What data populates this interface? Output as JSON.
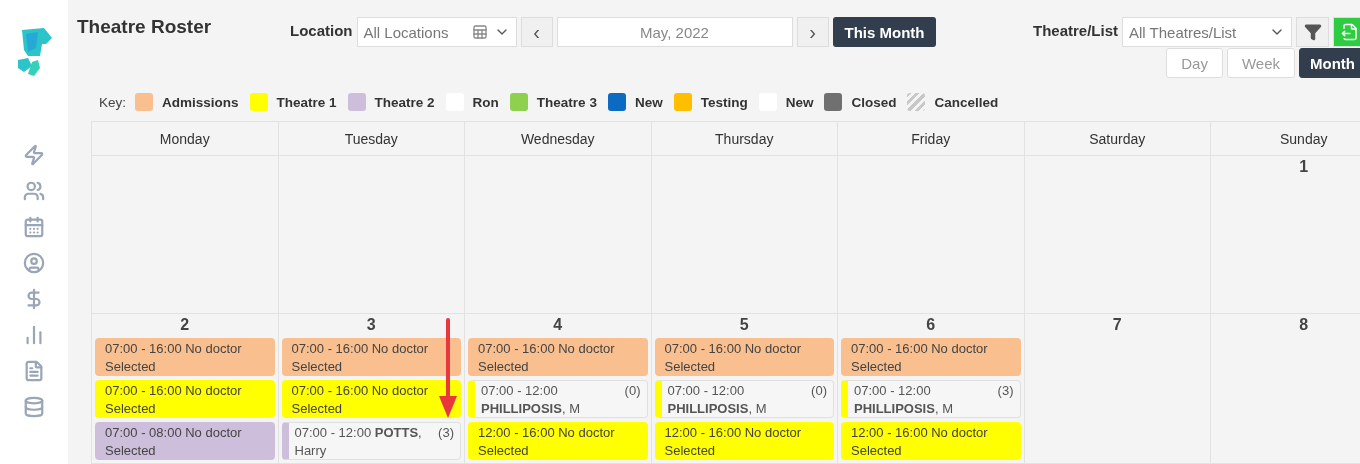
{
  "title": "Theatre Roster",
  "location": {
    "label": "Location",
    "value": "All Locations"
  },
  "date_nav": {
    "prev": "‹",
    "value": "May, 2022",
    "next": "›",
    "today": "This Month"
  },
  "theatre_filter": {
    "label": "Theatre/List",
    "value": "All Theatres/List"
  },
  "views": [
    {
      "label": "Day",
      "selected": false
    },
    {
      "label": "Week",
      "selected": false
    },
    {
      "label": "Month",
      "selected": true
    }
  ],
  "key": {
    "label": "Key:",
    "items": [
      {
        "label": "Admissions",
        "kind": "solid",
        "color": "#f9bf8f"
      },
      {
        "label": "Theatre 1",
        "kind": "solid",
        "color": "#ffff00"
      },
      {
        "label": "Theatre 2",
        "kind": "solid",
        "color": "#cdbfdc"
      },
      {
        "label": "Ron",
        "kind": "solid",
        "color": "#ffffff"
      },
      {
        "label": "Theatre 3",
        "kind": "solid",
        "color": "#8fd14f"
      },
      {
        "label": "New",
        "kind": "solid",
        "color": "#0b6bc2"
      },
      {
        "label": "Testing",
        "kind": "solid",
        "color": "#ffbf00"
      },
      {
        "label": "New",
        "kind": "solid",
        "color": "#ffffff"
      },
      {
        "label": "Closed",
        "kind": "solid",
        "color": "#707070"
      },
      {
        "label": "Cancelled",
        "kind": "hatched",
        "color": "#c8c8c8"
      }
    ]
  },
  "weekdays": [
    "Monday",
    "Tuesday",
    "Wednesday",
    "Thursday",
    "Friday",
    "Saturday",
    "Sunday"
  ],
  "weeks": [
    {
      "days": [
        {
          "kind": "blank"
        },
        {
          "kind": "blank"
        },
        {
          "kind": "blank"
        },
        {
          "kind": "blank"
        },
        {
          "kind": "blank"
        },
        {
          "kind": "blank"
        },
        {
          "kind": "day",
          "number": "1"
        }
      ]
    },
    {
      "days": [
        {
          "number": "2",
          "events": [
            {
              "kind": "block",
              "color": "#f9bf8f",
              "text": "07:00 - 16:00 No doctor Selected"
            },
            {
              "kind": "block",
              "color": "#ffff00",
              "text": "07:00 - 16:00 No doctor Selected"
            },
            {
              "kind": "block",
              "color": "#cdbfdc",
              "text": "07:00 - 08:00 No doctor Selected"
            }
          ]
        },
        {
          "number": "3",
          "events": [
            {
              "kind": "block",
              "color": "#f9bf8f",
              "text": "07:00 - 16:00 No doctor Selected"
            },
            {
              "kind": "block",
              "color": "#ffff00",
              "text": "07:00 - 16:00 No doctor Selected"
            },
            {
              "kind": "assigned",
              "color": "#cdbfdc",
              "text": "07:00 - 12:00 **POTTS**, Harry",
              "count": "(3)"
            }
          ]
        },
        {
          "number": "4",
          "events": [
            {
              "kind": "block",
              "color": "#f9bf8f",
              "text": "07:00 - 16:00 No doctor Selected"
            },
            {
              "kind": "assigned",
              "color": "#ffff00",
              "text": "07:00 - 12:00",
              "doctor": "**PHILLIPOSIS**, M",
              "count": "(0)"
            },
            {
              "kind": "block",
              "color": "#ffff00",
              "text": "12:00 - 16:00 No doctor Selected"
            }
          ]
        },
        {
          "number": "5",
          "events": [
            {
              "kind": "block",
              "color": "#f9bf8f",
              "text": "07:00 - 16:00 No doctor Selected"
            },
            {
              "kind": "assigned",
              "color": "#ffff00",
              "text": "07:00 - 12:00",
              "doctor": "**PHILLIPOSIS**, M",
              "count": "(0)"
            },
            {
              "kind": "block",
              "color": "#ffff00",
              "text": "12:00 - 16:00 No doctor Selected"
            }
          ]
        },
        {
          "number": "6",
          "events": [
            {
              "kind": "block",
              "color": "#f9bf8f",
              "text": "07:00 - 16:00 No doctor Selected"
            },
            {
              "kind": "assigned",
              "color": "#ffff00",
              "text": "07:00 - 12:00",
              "doctor": "**PHILLIPOSIS**, M",
              "count": "(3)"
            },
            {
              "kind": "block",
              "color": "#ffff00",
              "text": "12:00 - 16:00 No doctor Selected"
            }
          ]
        },
        {
          "number": "7"
        },
        {
          "number": "8"
        }
      ]
    }
  ]
}
